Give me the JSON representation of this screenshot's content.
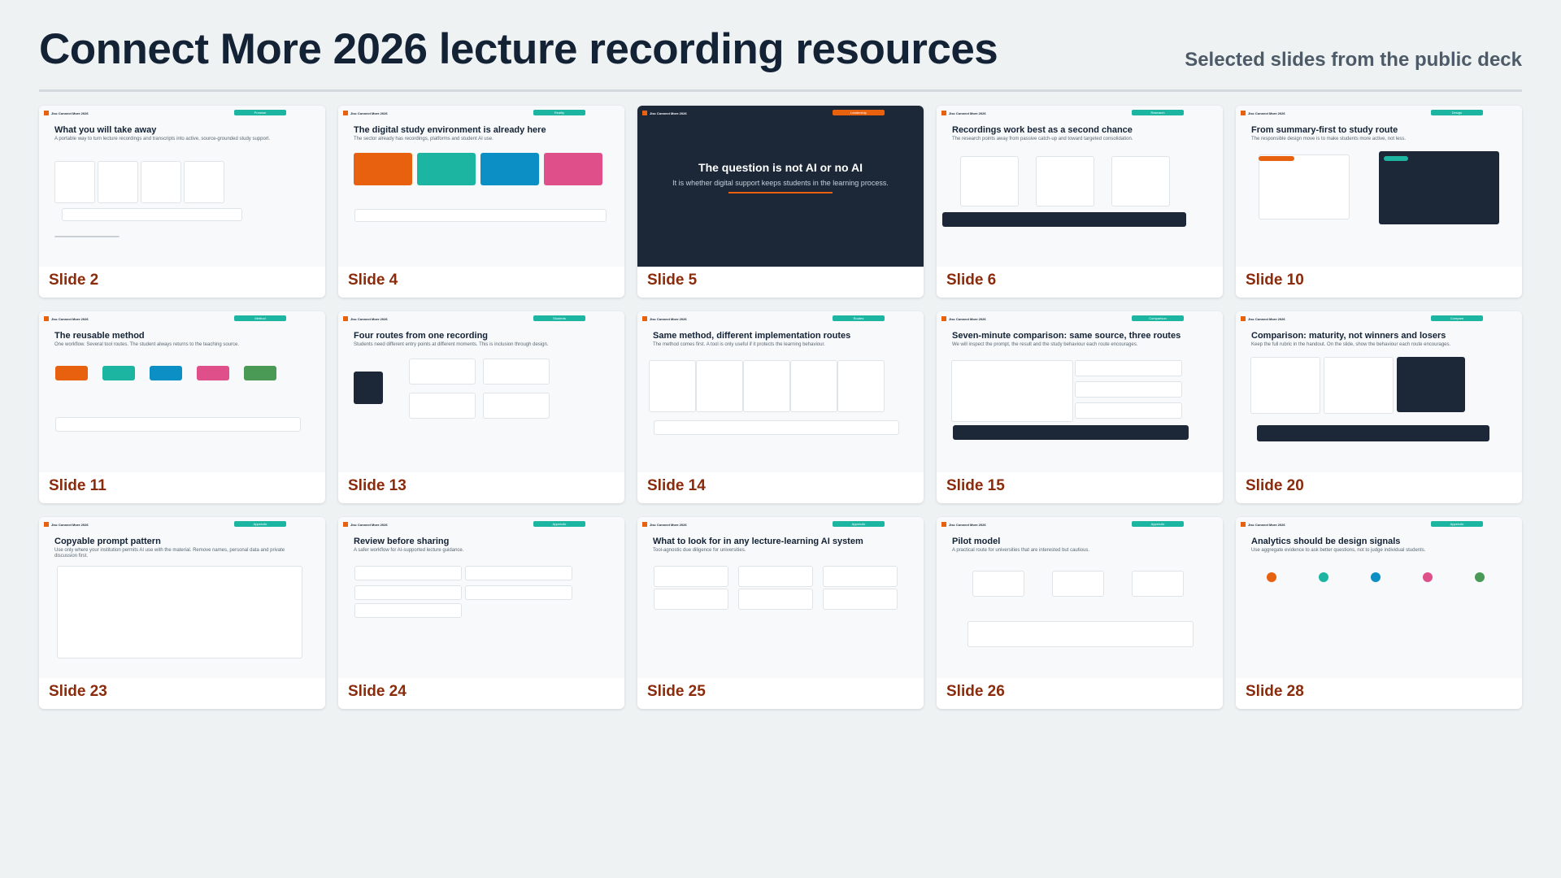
{
  "page": {
    "title": "Connect More 2026 lecture recording resources",
    "subtitle": "Selected slides from the public deck"
  },
  "slides": [
    {
      "label": "Slide 2",
      "mini_title": "What you will take away",
      "mini_desc": "A portable way to turn lecture recordings and transcripts into active, source-grounded study support.",
      "tag": "Promise",
      "dark": false,
      "dark_heading": "",
      "dark_sub": ""
    },
    {
      "label": "Slide 4",
      "mini_title": "The digital study environment is already here",
      "mini_desc": "The sector already has recordings, platforms and student AI use.",
      "tag": "Reality",
      "dark": false,
      "dark_heading": "",
      "dark_sub": ""
    },
    {
      "label": "Slide 5",
      "mini_title": "",
      "mini_desc": "",
      "tag": "Leadership",
      "dark": true,
      "dark_heading": "The question is not AI or no AI",
      "dark_sub": "It is whether digital support keeps students in the learning process."
    },
    {
      "label": "Slide 6",
      "mini_title": "Recordings work best as a second chance",
      "mini_desc": "The research points away from passive catch-up and toward targeted consolidation.",
      "tag": "Research",
      "dark": false,
      "dark_heading": "",
      "dark_sub": ""
    },
    {
      "label": "Slide 10",
      "mini_title": "From summary-first to study route",
      "mini_desc": "The responsible design move is to make students more active, not less.",
      "tag": "Design",
      "dark": false,
      "dark_heading": "",
      "dark_sub": ""
    },
    {
      "label": "Slide 11",
      "mini_title": "The reusable method",
      "mini_desc": "One workflow. Several tool routes. The student always returns to the teaching source.",
      "tag": "Method",
      "dark": false,
      "dark_heading": "",
      "dark_sub": ""
    },
    {
      "label": "Slide 13",
      "mini_title": "Four routes from one recording",
      "mini_desc": "Students need different entry points at different moments. This is inclusion through design.",
      "tag": "Students",
      "dark": false,
      "dark_heading": "",
      "dark_sub": ""
    },
    {
      "label": "Slide 14",
      "mini_title": "Same method, different implementation routes",
      "mini_desc": "The method comes first. A tool is only useful if it protects the learning behaviour.",
      "tag": "Routes",
      "dark": false,
      "dark_heading": "",
      "dark_sub": ""
    },
    {
      "label": "Slide 15",
      "mini_title": "Seven-minute comparison: same source, three routes",
      "mini_desc": "We will inspect the prompt, the result and the study behaviour each route encourages.",
      "tag": "Comparison",
      "dark": false,
      "dark_heading": "",
      "dark_sub": ""
    },
    {
      "label": "Slide 20",
      "mini_title": "Comparison: maturity, not winners and losers",
      "mini_desc": "Keep the full rubric in the handout. On the slide, show the behaviour each route encourages.",
      "tag": "Compare",
      "dark": false,
      "dark_heading": "",
      "dark_sub": ""
    },
    {
      "label": "Slide 23",
      "mini_title": "Copyable prompt pattern",
      "mini_desc": "Use only where your institution permits AI use with the material. Remove names, personal data and private discussion first.",
      "tag": "Appendix",
      "dark": false,
      "dark_heading": "",
      "dark_sub": ""
    },
    {
      "label": "Slide 24",
      "mini_title": "Review before sharing",
      "mini_desc": "A safer workflow for AI-supported lecture guidance.",
      "tag": "Appendix",
      "dark": false,
      "dark_heading": "",
      "dark_sub": ""
    },
    {
      "label": "Slide 25",
      "mini_title": "What to look for in any lecture-learning AI system",
      "mini_desc": "Tool-agnostic due diligence for universities.",
      "tag": "Appendix",
      "dark": false,
      "dark_heading": "",
      "dark_sub": ""
    },
    {
      "label": "Slide 26",
      "mini_title": "Pilot model",
      "mini_desc": "A practical route for universities that are interested but cautious.",
      "tag": "Appendix",
      "dark": false,
      "dark_heading": "",
      "dark_sub": ""
    },
    {
      "label": "Slide 28",
      "mini_title": "Analytics should be design signals",
      "mini_desc": "Use aggregate evidence to ask better questions, not to judge individual students.",
      "tag": "Appendix",
      "dark": false,
      "dark_heading": "",
      "dark_sub": ""
    }
  ],
  "mini_brand": "Jisc Connect More 2026",
  "colors": {
    "accent_orange": "#e8610f",
    "teal": "#1bb5a2",
    "navy": "#1c2838",
    "caption": "#8a2b0c"
  }
}
